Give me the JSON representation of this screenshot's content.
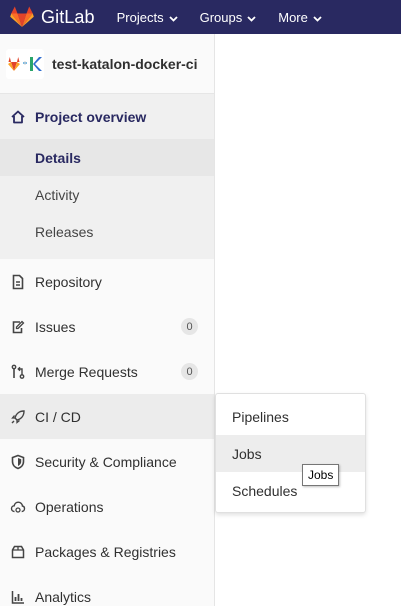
{
  "navbar": {
    "brand": "GitLab",
    "items": [
      {
        "label": "Projects"
      },
      {
        "label": "Groups"
      },
      {
        "label": "More"
      }
    ]
  },
  "project": {
    "name": "test-katalon-docker-ci"
  },
  "sidebar": {
    "overview": {
      "label": "Project overview",
      "subitems": [
        {
          "label": "Details"
        },
        {
          "label": "Activity"
        },
        {
          "label": "Releases"
        }
      ]
    },
    "items": [
      {
        "label": "Repository",
        "icon": "doc-icon"
      },
      {
        "label": "Issues",
        "icon": "issues-icon",
        "badge": "0"
      },
      {
        "label": "Merge Requests",
        "icon": "merge-request-icon",
        "badge": "0"
      },
      {
        "label": "CI / CD",
        "icon": "rocket-icon"
      },
      {
        "label": "Security & Compliance",
        "icon": "shield-icon"
      },
      {
        "label": "Operations",
        "icon": "cloud-gear-icon"
      },
      {
        "label": "Packages & Registries",
        "icon": "package-icon"
      },
      {
        "label": "Analytics",
        "icon": "chart-icon"
      }
    ]
  },
  "flyout": {
    "items": [
      {
        "label": "Pipelines"
      },
      {
        "label": "Jobs"
      },
      {
        "label": "Schedules"
      }
    ]
  },
  "tooltip": "Jobs",
  "colors": {
    "navbar": "#292961",
    "accent": "#292961",
    "logo_orange": "#fc6d26",
    "logo_red": "#e24329"
  }
}
